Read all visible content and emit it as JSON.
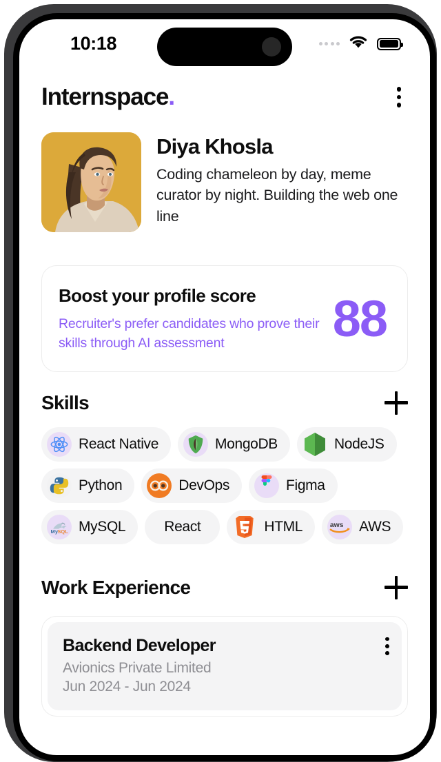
{
  "status_bar": {
    "time": "10:18",
    "signal_icon": "signal-dots-icon",
    "wifi_icon": "wifi-icon",
    "battery_icon": "battery-full-icon"
  },
  "header": {
    "brand": "Internspace",
    "brand_dot": ".",
    "menu_icon": "kebab-menu-icon",
    "accent_color": "#8b5cf6"
  },
  "profile": {
    "avatar_alt": "profile-photo",
    "avatar_bg": "#dca93a",
    "name": "Diya Khosla",
    "bio": "Coding chameleon by day, meme curator by night. Building the web one line"
  },
  "boost_card": {
    "title": "Boost your profile score",
    "subtitle": "Recruiter's prefer candidates who prove their skills through AI assessment",
    "score": "88",
    "score_color": "#8b5cf6"
  },
  "skills_section": {
    "title": "Skills",
    "add_label": "+",
    "add_icon": "plus-icon",
    "chips": [
      {
        "label": "React Native",
        "icon": "react-native-icon"
      },
      {
        "label": "MongoDB",
        "icon": "mongodb-icon"
      },
      {
        "label": "NodeJS",
        "icon": "nodejs-icon"
      },
      {
        "label": "Python",
        "icon": "python-icon"
      },
      {
        "label": "DevOps",
        "icon": "devops-icon"
      },
      {
        "label": "Figma",
        "icon": "figma-icon"
      },
      {
        "label": "MySQL",
        "icon": "mysql-icon"
      },
      {
        "label": "React",
        "icon": ""
      },
      {
        "label": "HTML",
        "icon": "html5-icon"
      },
      {
        "label": "AWS",
        "icon": "aws-icon"
      }
    ]
  },
  "work_section": {
    "title": "Work Experience",
    "add_label": "+",
    "add_icon": "plus-icon",
    "entries": [
      {
        "role": "Backend Developer",
        "company": "Avionics Private Limited",
        "dates": "Jun 2024 - Jun 2024",
        "menu_icon": "kebab-menu-icon"
      }
    ]
  }
}
